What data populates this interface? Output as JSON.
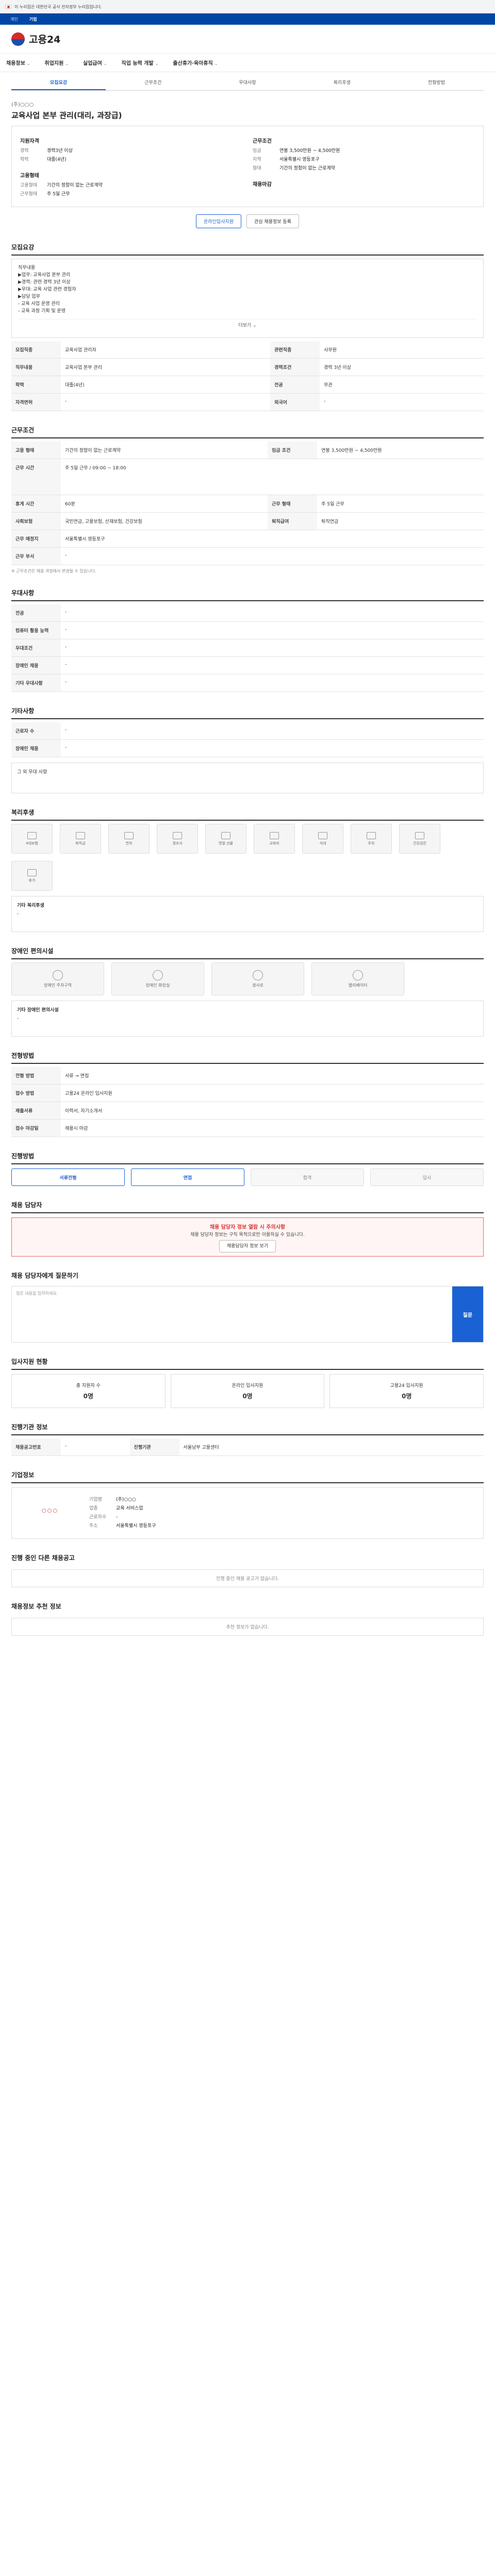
{
  "gov_banner": {
    "text": "이 누리집은 대한민국 공식 전자정부 누리집입니다."
  },
  "util_bar": {
    "items": [
      "개인",
      "기업"
    ]
  },
  "header": {
    "brand": "고용24"
  },
  "gnb": {
    "items": [
      {
        "label": "채용정보"
      },
      {
        "label": "취업지원"
      },
      {
        "label": "실업급여"
      },
      {
        "label": "직업 능력 개발"
      },
      {
        "label": "출산휴가·육아휴직"
      }
    ],
    "caret": "⌄"
  },
  "tabs": [
    "모집요강",
    "근무조건",
    "우대사항",
    "복리후생",
    "전형방법"
  ],
  "job": {
    "company": "(주)○○○",
    "title": "교육사업 본부 관리(대리, 과장급)",
    "recruit": {
      "head": "지원자격",
      "rows": [
        {
          "k": "경력",
          "v": "경력3년 이상"
        },
        {
          "k": "학력",
          "v": "대졸(4년)"
        }
      ]
    },
    "conditions": {
      "head": "근무조건",
      "rows": [
        {
          "k": "임금",
          "v": "연봉 3,500만원 ~ 4,500만원"
        },
        {
          "k": "지역",
          "v": "서울특별시 영등포구"
        },
        {
          "k": "형태",
          "v": "기간의 정함이 없는 근로계약"
        }
      ]
    },
    "type_head": "고용형태",
    "type_rows": [
      {
        "k": "고용형태",
        "v": "기간의 정함이 없는 근로계약"
      },
      {
        "k": "근무형태",
        "v": "주 5일 근무"
      }
    ],
    "apply_head": "채용마감",
    "buttons": {
      "apply": "온라인입사지원",
      "scrap": "관심 채용정보 등록"
    }
  },
  "sections": {
    "recruit": {
      "title": "모집요강",
      "desc": [
        "직무내용",
        "▶업무: 교육사업 본부 관리",
        "▶경력: 관련 경력 3년 이상",
        "▶우대: 교육 사업 관련 경험자",
        "▶담당 업무",
        "- 교육 사업 운영 관리",
        "- 교육 과정 기획 및 운영"
      ],
      "more": "더보기 ⌄",
      "rows": [
        {
          "h": "모집직종",
          "v": "교육사업 관리자",
          "h2": "관련직종",
          "v2": "사무원"
        },
        {
          "h": "직무내용",
          "v": "교육사업 본부 관리",
          "h2": "경력조건",
          "v2": "경력 3년 이상"
        },
        {
          "h": "학력",
          "v": "대졸(4년)",
          "h2": "전공",
          "v2": "무관"
        },
        {
          "h": "자격면허",
          "v": "-",
          "h2": "외국어",
          "v2": "-"
        }
      ]
    },
    "work": {
      "title": "근무조건",
      "rows": [
        {
          "h": "고용 형태",
          "v": "기간의 정함이 없는 근로계약",
          "h2": "임금 조건",
          "v2": "연봉 3,500만원 ~ 4,500만원"
        },
        {
          "h": "근무 시간",
          "v": "주 5일 근무 / 09:00 ~ 18:00",
          "h2": "",
          "v2": ""
        },
        {
          "h": "휴게 시간",
          "v": "60분",
          "h2": "근무 형태",
          "v2": "주 5일 근무"
        },
        {
          "h": "사회보험",
          "v": "국민연금, 고용보험, 산재보험, 건강보험",
          "h2": "퇴직급여",
          "v2": "퇴직연금"
        },
        {
          "h": "근무 예정지",
          "v": "서울특별시 영등포구",
          "h2": "",
          "v2": ""
        },
        {
          "h": "근무 부서",
          "v": "-",
          "h2": "",
          "v2": ""
        }
      ],
      "note": "※ 근무조건은 채용 과정에서 변경될 수 있습니다."
    },
    "prefer": {
      "title": "우대사항",
      "rows": [
        {
          "h": "전공",
          "v": "-"
        },
        {
          "h": "컴퓨터 활용 능력",
          "v": "-"
        },
        {
          "h": "우대조건",
          "v": "-"
        },
        {
          "h": "장애인 채용",
          "v": "-"
        },
        {
          "h": "기타 우대사항",
          "v": "-"
        }
      ]
    },
    "etc": {
      "title": "기타사항",
      "rows": [
        {
          "h": "근로자 수",
          "v": "-"
        },
        {
          "h": "장애인 채용",
          "v": "-"
        }
      ],
      "sub": "그 외 우대 사항"
    },
    "welfare": {
      "title": "복리후생",
      "items": [
        "4대보험",
        "퇴직금",
        "연차",
        "경조사",
        "명절 선물",
        "교육비",
        "식대",
        "주차",
        "건강검진",
        "휴가"
      ],
      "sub": "기타 복리후생",
      "sub_v": "-"
    },
    "disabled": {
      "title": "장애인 편의시설",
      "items": [
        "장애인 주차구역",
        "장애인 화장실",
        "경사로",
        "엘리베이터"
      ],
      "sub": "기타 장애인 편의시설",
      "sub_v": "-"
    },
    "selection": {
      "title": "전형방법",
      "rows": [
        {
          "h": "전형 방법",
          "v": "서류 → 면접"
        },
        {
          "h": "접수 방법",
          "v": "고용24 온라인 입사지원"
        },
        {
          "h": "제출서류",
          "v": "이력서, 자기소개서"
        },
        {
          "h": "접수 마감일",
          "v": "채용시 마감"
        }
      ]
    },
    "process": {
      "title": "진행방법",
      "steps": [
        "서류전형",
        "면접",
        "합격",
        "입사"
      ]
    },
    "contact": {
      "title": "채용 담당자",
      "alert_title": "채용 담당자 정보 열람 시 주의사항",
      "alert_text": "채용 담당자 정보는 구직 목적으로만 이용하실 수 있습니다.",
      "btn": "채용담당자 정보 보기"
    },
    "inquiry": {
      "title": "채용 담당자에게 질문하기",
      "placeholder": "질문 내용을 입력하세요.",
      "send": "질문"
    },
    "stats": {
      "title": "입사지원 현황",
      "items": [
        {
          "label": "총 지원자 수",
          "value": "0명"
        },
        {
          "label": "온라인 입사지원",
          "value": "0명"
        },
        {
          "label": "고용24 입사지원",
          "value": "0명"
        }
      ]
    },
    "info": {
      "title": "진행기관 정보",
      "rows": [
        {
          "h": "채용공고번호",
          "v": "-",
          "h2": "진행기관",
          "v2": "서울남부 고용센터"
        }
      ]
    },
    "company": {
      "title": "기업정보",
      "logo": "○○○",
      "rows": [
        {
          "k": "기업명",
          "v": "(주)○○○"
        },
        {
          "k": "업종",
          "v": "교육 서비스업"
        },
        {
          "k": "근로자수",
          "v": "-"
        },
        {
          "k": "주소",
          "v": "서울특별시 영등포구"
        }
      ]
    },
    "other": {
      "title": "진행 중인 다른 채용공고",
      "empty": "진행 중인 채용 공고가 없습니다."
    },
    "recommend": {
      "title": "채용정보 추천 정보",
      "empty": "추천 정보가 없습니다."
    }
  }
}
